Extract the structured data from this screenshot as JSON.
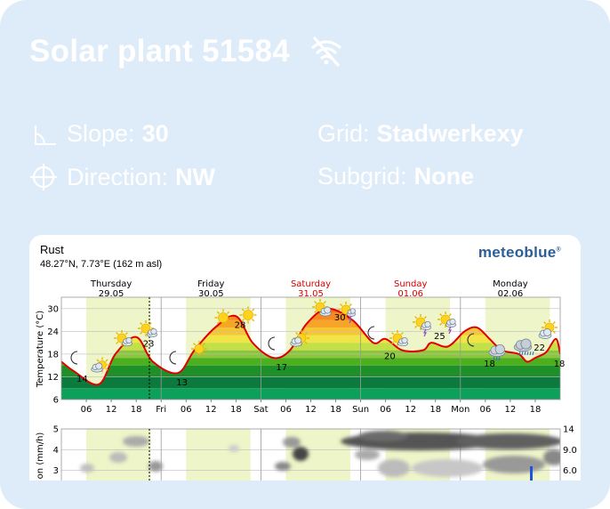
{
  "plant": {
    "title": "Solar plant 51584",
    "offline_icon": "wifi-off-icon"
  },
  "attributes": {
    "slope_label": "Slope:",
    "slope_value": "30",
    "direction_label": "Direction:",
    "direction_value": "NW",
    "grid_label": "Grid:",
    "grid_value": "Stadwerkexy",
    "subgrid_label": "Subgrid:",
    "subgrid_value": "None",
    "slope_icon": "angle-icon",
    "direction_icon": "compass-crosshair-icon"
  },
  "widget": {
    "location": "Rust",
    "coordinates": "48.27°N, 7.73°E (162 m asl)",
    "brand": "meteoblue",
    "brand_mark": "®"
  },
  "colors": {
    "card_bg": "#deebf9",
    "temp_line": "#e00000",
    "day_highlight": "#eef5c8",
    "weekend_day": "#d40000",
    "brand": "#2a5e9a"
  },
  "chart_data": [
    {
      "type": "line",
      "ylabel": "Temperature (°C)",
      "ylim": [
        6,
        33
      ],
      "yticks": [
        6,
        12,
        18,
        24,
        30
      ],
      "days": [
        {
          "name": "Thursday",
          "date": "29.05",
          "weekend": false
        },
        {
          "name": "Friday",
          "date": "30.05",
          "weekend": false
        },
        {
          "name": "Saturday",
          "date": "31.05",
          "weekend": true
        },
        {
          "name": "Sunday",
          "date": "01.06",
          "weekend": true
        },
        {
          "name": "Monday",
          "date": "02.06",
          "weekend": false
        }
      ],
      "xtick_labels": [
        "06",
        "12",
        "18",
        "Fri",
        "06",
        "12",
        "18",
        "Sat",
        "06",
        "12",
        "18",
        "Sun",
        "06",
        "12",
        "18",
        "Mon",
        "06",
        "12",
        "18"
      ],
      "hours": [
        0,
        6,
        12,
        18,
        24,
        30,
        36,
        42,
        48,
        54,
        60,
        66,
        72,
        78,
        84,
        90,
        96,
        102,
        108,
        114,
        120
      ],
      "values": [
        16,
        13.5,
        10,
        18,
        22.5,
        16,
        13,
        19,
        25,
        28,
        21,
        17,
        19,
        26,
        30,
        27,
        21,
        22,
        19,
        19,
        21,
        20,
        24,
        25,
        22,
        19,
        18,
        16,
        17,
        18,
        19,
        22,
        18
      ],
      "values_hours": [
        0,
        3,
        9,
        13,
        18,
        22,
        28,
        32,
        37,
        42,
        46,
        51,
        55,
        59,
        64,
        70,
        75,
        78,
        82,
        87,
        89,
        93,
        97,
        100,
        103,
        106,
        110,
        112,
        114,
        116,
        117,
        119,
        120
      ],
      "annotations": [
        {
          "hour": 5,
          "value": 14,
          "label": "14"
        },
        {
          "hour": 21,
          "value": 23,
          "label": "23"
        },
        {
          "hour": 29,
          "value": 13,
          "label": "13"
        },
        {
          "hour": 43,
          "value": 28,
          "label": "28"
        },
        {
          "hour": 53,
          "value": 17,
          "label": "17"
        },
        {
          "hour": 67,
          "value": 30,
          "label": "30"
        },
        {
          "hour": 79,
          "value": 20,
          "label": "20"
        },
        {
          "hour": 91,
          "value": 25,
          "label": "25"
        },
        {
          "hour": 103,
          "value": 18,
          "label": "18"
        },
        {
          "hour": 115,
          "value": 22,
          "label": "22"
        },
        {
          "hour": 119.8,
          "value": 18,
          "label": "18"
        }
      ]
    },
    {
      "type": "area",
      "ylabel": "on (mm/h)",
      "ylim_left": [
        2,
        5
      ],
      "yticks_left": [
        3,
        4,
        5
      ],
      "yticks_right": [
        "14",
        "9.0",
        "6.0"
      ]
    }
  ]
}
